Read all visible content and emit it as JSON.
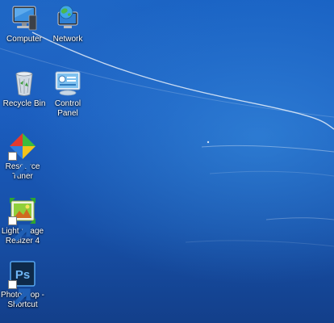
{
  "desktop": {
    "icons": [
      {
        "label": "Computer"
      },
      {
        "label": "Network"
      },
      {
        "label": "Recycle Bin"
      },
      {
        "label": "Control Panel"
      },
      {
        "label": "Resource Tuner"
      },
      {
        "label": "Light Image Resizer 4"
      },
      {
        "label": "Photoshop - Shortcut"
      }
    ]
  },
  "colors": {
    "background_top": "#1a63c4",
    "background_bottom": "#133f8a",
    "label_text": "#ffffff"
  }
}
